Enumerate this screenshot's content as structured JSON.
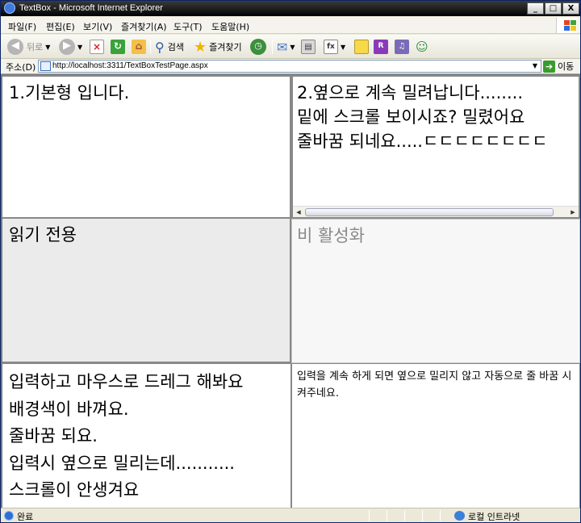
{
  "window": {
    "title": "TextBox - Microsoft Internet Explorer",
    "controls": {
      "minimize": "_",
      "maximize": "□",
      "close": "X"
    }
  },
  "menubar": {
    "items": [
      "파일(F)",
      "편집(E)",
      "보기(V)",
      "즐겨찾기(A)",
      "도구(T)",
      "도움말(H)"
    ]
  },
  "toolbar": {
    "back_label": "뒤로",
    "search_label": "검색",
    "favorites_label": "즐겨찾기"
  },
  "address": {
    "label": "주소(D)",
    "url": "http://localhost:3311/TextBoxTestPage.aspx",
    "go_label": "이동"
  },
  "textboxes": {
    "basic": "1.기본형 입니다.",
    "nowrap": "2.옆으로 계속 밀려납니다........\n밑에 스크롤 보이시죠? 밀렸어요\n줄바꿈 되네요.....ㄷㄷㄷㄷㄷㄷㄷㄷ",
    "readonly": "읽기 전용",
    "disabled": "비 활성화",
    "drag": "입력하고 마우스로 드레그 해봐요\n배경색이 바껴요.\n줄바꿈 되요.\n입력시 옆으로 밀리는데...........\n스크롤이 안생겨요",
    "wrap": "입력을 계속 하게 되면 옆으로 밀리지 않고 자동으로 줄 바꿈 시켜주네요."
  },
  "status": {
    "text": "완료",
    "zone": "로컬 인트라넷"
  }
}
